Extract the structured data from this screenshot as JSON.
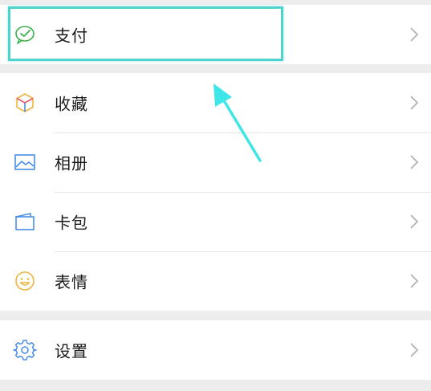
{
  "menu": {
    "payment": {
      "label": "支付",
      "icon": "wechat-pay-icon"
    },
    "favorites": {
      "label": "收藏",
      "icon": "cube-icon"
    },
    "album": {
      "label": "相册",
      "icon": "image-icon"
    },
    "cards": {
      "label": "卡包",
      "icon": "wallet-icon"
    },
    "stickers": {
      "label": "表情",
      "icon": "smiley-icon"
    },
    "settings": {
      "label": "设置",
      "icon": "gear-icon"
    }
  },
  "colors": {
    "background": "#ededed",
    "row": "#ffffff",
    "highlight": "#4fd3cf",
    "arrow": "#3fe6e8",
    "text": "#1a1a1a",
    "chevron": "#b2b2b2"
  }
}
